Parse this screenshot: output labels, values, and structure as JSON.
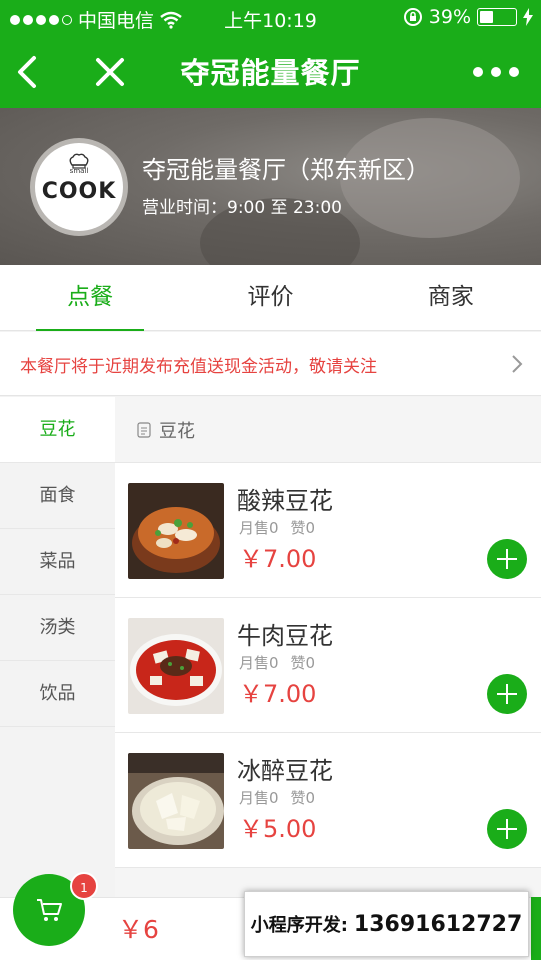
{
  "status_bar": {
    "carrier": "中国电信",
    "time": "上午10:19",
    "battery_text": "39%",
    "battery_level": 0.39
  },
  "nav": {
    "title": "夺冠能量餐厅"
  },
  "shop": {
    "logo_text": "COOK",
    "logo_small_text": "small",
    "name": "夺冠能量餐厅（郑东新区）",
    "hours": "营业时间：9:00 至 23:00"
  },
  "tabs": [
    {
      "label": "点餐",
      "active": true
    },
    {
      "label": "评价",
      "active": false
    },
    {
      "label": "商家",
      "active": false
    }
  ],
  "notice": {
    "text": "本餐厅将于近期发布充值送现金活动，敬请关注",
    "color": "#e64340"
  },
  "categories": [
    {
      "label": "豆花",
      "active": true
    },
    {
      "label": "面食",
      "active": false
    },
    {
      "label": "菜品",
      "active": false
    },
    {
      "label": "汤类",
      "active": false
    },
    {
      "label": "饮品",
      "active": false
    }
  ],
  "section": {
    "title": "豆花"
  },
  "dishes": [
    {
      "name": "酸辣豆花",
      "sales": "月售0",
      "likes": "赞0",
      "price": "￥7.00"
    },
    {
      "name": "牛肉豆花",
      "sales": "月售0",
      "likes": "赞0",
      "price": "￥7.00"
    },
    {
      "name": "冰醉豆花",
      "sales": "月售0",
      "likes": "赞0",
      "price": "￥5.00"
    }
  ],
  "cart": {
    "badge_count": "1",
    "total": "￥6"
  },
  "promo": {
    "label": "小程序开发:",
    "phone": "13691612727"
  },
  "colors": {
    "brand_green": "#1aad19",
    "price_red": "#e64340"
  }
}
